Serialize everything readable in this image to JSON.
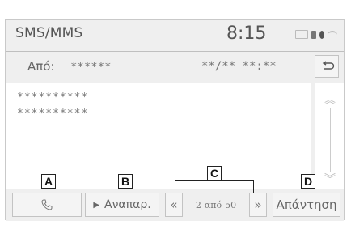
{
  "header": {
    "title": "SMS/MMS",
    "time": "8:15"
  },
  "message": {
    "from_label": "Από:",
    "from_value": "******",
    "date_value": "**/** **:**",
    "body_lines": [
      "**********",
      "**********"
    ]
  },
  "toolbar": {
    "play_label": "Αναπαρ.",
    "play_glyph": "▶",
    "page_current": "2",
    "page_of": "από",
    "page_total": "50",
    "reply_label": "Απάντηση"
  },
  "markers": {
    "a": "A",
    "b": "B",
    "c": "C",
    "d": "D"
  },
  "icons": {
    "call": "phone-icon",
    "back": "back-arrow-icon",
    "prev": "«",
    "next": "»",
    "scroll_up": "︽",
    "scroll_down": "︾"
  }
}
